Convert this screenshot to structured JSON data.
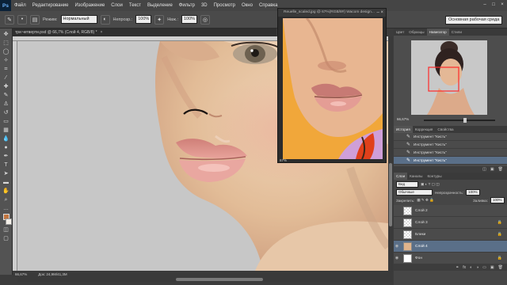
{
  "menubar": {
    "logo": "Ps",
    "items": [
      "Файл",
      "Редактирование",
      "Изображение",
      "Слои",
      "Текст",
      "Выделение",
      "Фильтр",
      "3D",
      "Просмотр",
      "Окно",
      "Справка"
    ],
    "controls": [
      "–",
      "□",
      "×"
    ]
  },
  "options": {
    "mode_label": "Режим:",
    "mode_value": "Нормальный",
    "opacity_label": "Непрозр.:",
    "opacity_value": "100%",
    "flow_label": "Наж.:",
    "flow_value": "100%",
    "workspace": "Основная рабочая среда"
  },
  "document": {
    "tab_title": "три четверти.psd @ 66,7% (Слой 4, RGB/8) *",
    "tab_close": "×",
    "zoom": "66,67%",
    "doc_size": "Док: 24,9M/41,3M"
  },
  "float_window": {
    "title": "Reuelle_scaled.jpg @ 67%(RGB/8#) Wacom design...",
    "controls": "–  ×",
    "zoom": "67%"
  },
  "panels": {
    "top_tabs": [
      "Цвет",
      "Образцы",
      "Навигатор",
      "Стили"
    ],
    "top_active": 2,
    "navigator_zoom": "66,67%",
    "history_tabs": [
      "История",
      "Коррекция",
      "Свойства"
    ],
    "history_active": 0,
    "history_items": [
      "Инструмент \"Кисть\"",
      "Инструмент \"Кисть\"",
      "Инструмент \"Кисть\"",
      "Инструмент \"Кисть\""
    ],
    "history_active_index": 3,
    "layers_tabs": [
      "Слои",
      "Каналы",
      "Контуры"
    ],
    "layers_active": 0,
    "layers_kind": "Вид",
    "blend_mode": "Обычные",
    "opacity_label": "Непрозрачность:",
    "opacity_value": "100%",
    "lock_label": "Закрепить:",
    "fill_label": "Заливка:",
    "fill_value": "100%",
    "layers": [
      {
        "name": "Слой 2",
        "thumb": "checker",
        "visible": false,
        "locked": false,
        "active": false
      },
      {
        "name": "Слой 3",
        "thumb": "checker",
        "visible": false,
        "locked": true,
        "active": false
      },
      {
        "name": "Блики",
        "thumb": "checker",
        "visible": false,
        "locked": true,
        "active": false
      },
      {
        "name": "Слой 4",
        "thumb": "face",
        "visible": true,
        "locked": false,
        "active": true
      },
      {
        "name": "Фон",
        "thumb": "white",
        "visible": true,
        "locked": true,
        "active": false
      }
    ]
  }
}
